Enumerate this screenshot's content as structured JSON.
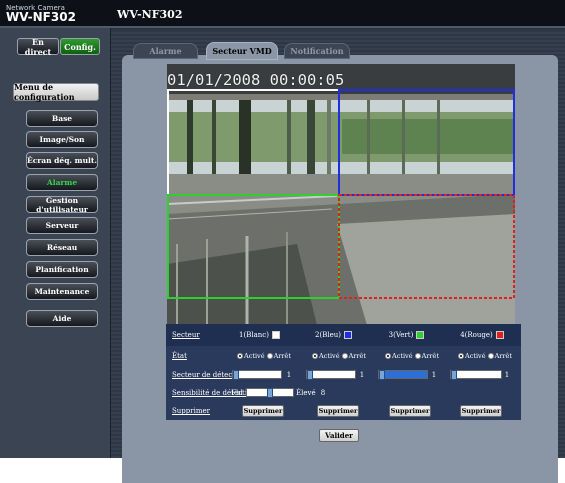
{
  "brand": {
    "line1": "Network Camera",
    "line2": "WV-NF302"
  },
  "header": {
    "title": "WV-NF302"
  },
  "mode": {
    "live": "En direct",
    "config": "Config."
  },
  "sidebar": {
    "title": "Menu de configuration",
    "items": [
      {
        "label": "Base"
      },
      {
        "label": "Image/Son"
      },
      {
        "label": "Écran déq. mult."
      },
      {
        "label": "Alarme"
      },
      {
        "label": "Gestion d'utilisateur"
      },
      {
        "label": "Serveur"
      },
      {
        "label": "Réseau"
      },
      {
        "label": "Planification"
      },
      {
        "label": "Maintenance"
      },
      {
        "label": "Aide"
      }
    ]
  },
  "tabs": {
    "alarm": "Alarme",
    "vmd": "Secteur VMD",
    "notification": "Notification"
  },
  "video": {
    "timestamp": "01/01/2008 00:00:05"
  },
  "grid": {
    "row_labels": {
      "sector": "Secteur",
      "state": "État",
      "detection_area": "Secteur de détection",
      "sensitivity": "Sensibilité de détection",
      "delete": "Supprimer"
    },
    "sectors": [
      {
        "name": "1(Blanc)",
        "color": "#ffffff",
        "state_on": "Activé",
        "state_off": "Arrêt",
        "area_value": "1",
        "delete": "Supprimer"
      },
      {
        "name": "2(Bleu)",
        "color": "#1f2fe0",
        "state_on": "Activé",
        "state_off": "Arrêt",
        "area_value": "1",
        "delete": "Supprimer"
      },
      {
        "name": "3(Vert)",
        "color": "#2fcf2f",
        "state_on": "Activé",
        "state_off": "Arrêt",
        "area_value": "1",
        "delete": "Supprimer"
      },
      {
        "name": "4(Rouge)",
        "color": "#e01f1f",
        "state_on": "Activé",
        "state_off": "Arrêt",
        "area_value": "1",
        "delete": "Supprimer"
      }
    ],
    "sensitivity": {
      "low": "Fbl",
      "high": "Élevé",
      "value": "8"
    }
  },
  "apply": "Valider"
}
